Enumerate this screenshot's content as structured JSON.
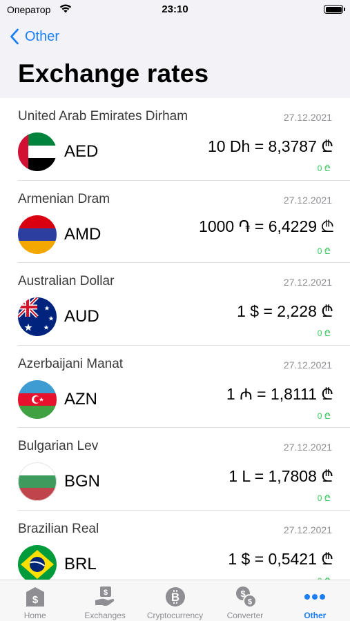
{
  "status_bar": {
    "carrier": "Оператор",
    "time": "23:10"
  },
  "nav": {
    "back_label": "Other",
    "title": "Exchange rates"
  },
  "rates": [
    {
      "name": "United Arab Emirates Dirham",
      "code": "AED",
      "date": "27.12.2021",
      "rate": "10 Dh = 8,3787 ₾",
      "change": "0 ₾",
      "flag": "uae-flag"
    },
    {
      "name": "Armenian Dram",
      "code": "AMD",
      "date": "27.12.2021",
      "rate": "1000 ֏ = 6,4229 ₾",
      "change": "0 ₾",
      "flag": "armenia-flag"
    },
    {
      "name": "Australian Dollar",
      "code": "AUD",
      "date": "27.12.2021",
      "rate": "1 $ = 2,228 ₾",
      "change": "0 ₾",
      "flag": "australia-flag"
    },
    {
      "name": "Azerbaijani Manat",
      "code": "AZN",
      "date": "27.12.2021",
      "rate": "1 ₼ = 1,8111 ₾",
      "change": "0 ₾",
      "flag": "azerbaijan-flag"
    },
    {
      "name": "Bulgarian Lev",
      "code": "BGN",
      "date": "27.12.2021",
      "rate": "1 L = 1,7808 ₾",
      "change": "0 ₾",
      "flag": "bulgaria-flag"
    },
    {
      "name": "Brazilian Real",
      "code": "BRL",
      "date": "27.12.2021",
      "rate": "1 $ = 0,5421 ₾",
      "change": "0 ₾",
      "flag": "brazil-flag"
    }
  ],
  "tabs": [
    {
      "label": "Home",
      "icon": "bank-icon"
    },
    {
      "label": "Exchanges",
      "icon": "exchange-hand-icon"
    },
    {
      "label": "Cryptocurrency",
      "icon": "bitcoin-icon"
    },
    {
      "label": "Converter",
      "icon": "converter-icon"
    },
    {
      "label": "Other",
      "icon": "more-dots-icon",
      "active": true
    }
  ],
  "colors": {
    "accent": "#1a7ef5",
    "positive": "#34c759",
    "header_bg": "#f2f2f7"
  }
}
